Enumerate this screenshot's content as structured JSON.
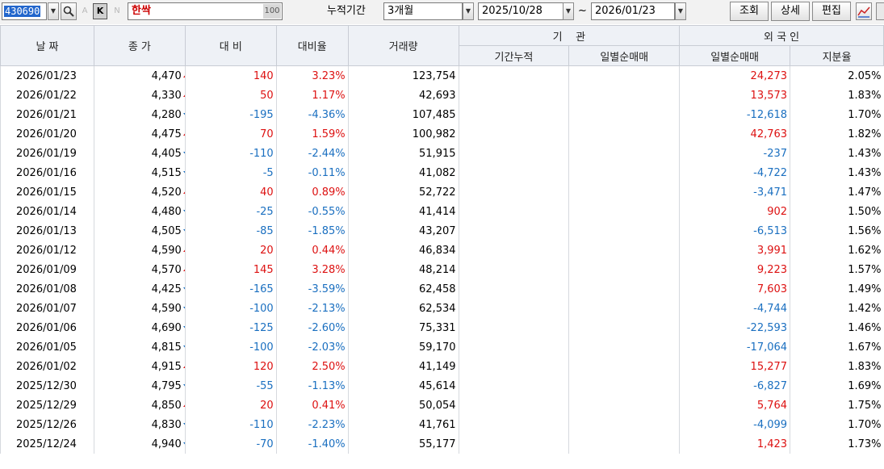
{
  "toolbar": {
    "stock_code": "430690",
    "letter_a": "A",
    "k_label": "K",
    "letter_n": "N",
    "stock_name": "한싹",
    "name_count": "100",
    "period_label": "누적기간",
    "period_value": "3개월",
    "date_from": "2025/10/28",
    "tilde": "~",
    "date_to": "2026/01/23",
    "search_label": "조회",
    "detail_label": "상세",
    "edit_label": "편집"
  },
  "headers": {
    "date": "날 짜",
    "close": "종 가",
    "change": "대 비",
    "rate": "대비율",
    "volume": "거래량",
    "institution": "기    관",
    "inst_cum": "기간누적",
    "inst_daily": "일별순매매",
    "foreign": "외 국 인",
    "foreign_daily": "일별순매매",
    "foreign_ratio": "지분율"
  },
  "colors": {
    "up": "#dd1111",
    "down": "#1a6fc0"
  },
  "rows": [
    {
      "date": "2026/01/23",
      "close": "4,470",
      "dir": "up",
      "change": "140",
      "rate": "3.23%",
      "volume": "123,754",
      "inst_cum": "",
      "inst_daily": "",
      "for_daily": "24,273",
      "for_dir": "up",
      "for_ratio": "2.05%"
    },
    {
      "date": "2026/01/22",
      "close": "4,330",
      "dir": "up",
      "change": "50",
      "rate": "1.17%",
      "volume": "42,693",
      "inst_cum": "",
      "inst_daily": "",
      "for_daily": "13,573",
      "for_dir": "up",
      "for_ratio": "1.83%"
    },
    {
      "date": "2026/01/21",
      "close": "4,280",
      "dir": "dn",
      "change": "-195",
      "rate": "-4.36%",
      "volume": "107,485",
      "inst_cum": "",
      "inst_daily": "",
      "for_daily": "-12,618",
      "for_dir": "dn",
      "for_ratio": "1.70%"
    },
    {
      "date": "2026/01/20",
      "close": "4,475",
      "dir": "up",
      "change": "70",
      "rate": "1.59%",
      "volume": "100,982",
      "inst_cum": "",
      "inst_daily": "",
      "for_daily": "42,763",
      "for_dir": "up",
      "for_ratio": "1.82%"
    },
    {
      "date": "2026/01/19",
      "close": "4,405",
      "dir": "dn",
      "change": "-110",
      "rate": "-2.44%",
      "volume": "51,915",
      "inst_cum": "",
      "inst_daily": "",
      "for_daily": "-237",
      "for_dir": "dn",
      "for_ratio": "1.43%"
    },
    {
      "date": "2026/01/16",
      "close": "4,515",
      "dir": "dn",
      "change": "-5",
      "rate": "-0.11%",
      "volume": "41,082",
      "inst_cum": "",
      "inst_daily": "",
      "for_daily": "-4,722",
      "for_dir": "dn",
      "for_ratio": "1.43%"
    },
    {
      "date": "2026/01/15",
      "close": "4,520",
      "dir": "up",
      "change": "40",
      "rate": "0.89%",
      "volume": "52,722",
      "inst_cum": "",
      "inst_daily": "",
      "for_daily": "-3,471",
      "for_dir": "dn",
      "for_ratio": "1.47%"
    },
    {
      "date": "2026/01/14",
      "close": "4,480",
      "dir": "dn",
      "change": "-25",
      "rate": "-0.55%",
      "volume": "41,414",
      "inst_cum": "",
      "inst_daily": "",
      "for_daily": "902",
      "for_dir": "up",
      "for_ratio": "1.50%"
    },
    {
      "date": "2026/01/13",
      "close": "4,505",
      "dir": "dn",
      "change": "-85",
      "rate": "-1.85%",
      "volume": "43,207",
      "inst_cum": "",
      "inst_daily": "",
      "for_daily": "-6,513",
      "for_dir": "dn",
      "for_ratio": "1.56%"
    },
    {
      "date": "2026/01/12",
      "close": "4,590",
      "dir": "up",
      "change": "20",
      "rate": "0.44%",
      "volume": "46,834",
      "inst_cum": "",
      "inst_daily": "",
      "for_daily": "3,991",
      "for_dir": "up",
      "for_ratio": "1.62%"
    },
    {
      "date": "2026/01/09",
      "close": "4,570",
      "dir": "up",
      "change": "145",
      "rate": "3.28%",
      "volume": "48,214",
      "inst_cum": "",
      "inst_daily": "",
      "for_daily": "9,223",
      "for_dir": "up",
      "for_ratio": "1.57%"
    },
    {
      "date": "2026/01/08",
      "close": "4,425",
      "dir": "dn",
      "change": "-165",
      "rate": "-3.59%",
      "volume": "62,458",
      "inst_cum": "",
      "inst_daily": "",
      "for_daily": "7,603",
      "for_dir": "up",
      "for_ratio": "1.49%"
    },
    {
      "date": "2026/01/07",
      "close": "4,590",
      "dir": "dn",
      "change": "-100",
      "rate": "-2.13%",
      "volume": "62,534",
      "inst_cum": "",
      "inst_daily": "",
      "for_daily": "-4,744",
      "for_dir": "dn",
      "for_ratio": "1.42%"
    },
    {
      "date": "2026/01/06",
      "close": "4,690",
      "dir": "dn",
      "change": "-125",
      "rate": "-2.60%",
      "volume": "75,331",
      "inst_cum": "",
      "inst_daily": "",
      "for_daily": "-22,593",
      "for_dir": "dn",
      "for_ratio": "1.46%"
    },
    {
      "date": "2026/01/05",
      "close": "4,815",
      "dir": "dn",
      "change": "-100",
      "rate": "-2.03%",
      "volume": "59,170",
      "inst_cum": "",
      "inst_daily": "",
      "for_daily": "-17,064",
      "for_dir": "dn",
      "for_ratio": "1.67%"
    },
    {
      "date": "2026/01/02",
      "close": "4,915",
      "dir": "up",
      "change": "120",
      "rate": "2.50%",
      "volume": "41,149",
      "inst_cum": "",
      "inst_daily": "",
      "for_daily": "15,277",
      "for_dir": "up",
      "for_ratio": "1.83%"
    },
    {
      "date": "2025/12/30",
      "close": "4,795",
      "dir": "dn",
      "change": "-55",
      "rate": "-1.13%",
      "volume": "45,614",
      "inst_cum": "",
      "inst_daily": "",
      "for_daily": "-6,827",
      "for_dir": "dn",
      "for_ratio": "1.69%"
    },
    {
      "date": "2025/12/29",
      "close": "4,850",
      "dir": "up",
      "change": "20",
      "rate": "0.41%",
      "volume": "50,054",
      "inst_cum": "",
      "inst_daily": "",
      "for_daily": "5,764",
      "for_dir": "up",
      "for_ratio": "1.75%"
    },
    {
      "date": "2025/12/26",
      "close": "4,830",
      "dir": "dn",
      "change": "-110",
      "rate": "-2.23%",
      "volume": "41,761",
      "inst_cum": "",
      "inst_daily": "",
      "for_daily": "-4,099",
      "for_dir": "dn",
      "for_ratio": "1.70%"
    },
    {
      "date": "2025/12/24",
      "close": "4,940",
      "dir": "dn",
      "change": "-70",
      "rate": "-1.40%",
      "volume": "55,177",
      "inst_cum": "",
      "inst_daily": "",
      "for_daily": "1,423",
      "for_dir": "up",
      "for_ratio": "1.73%"
    }
  ]
}
